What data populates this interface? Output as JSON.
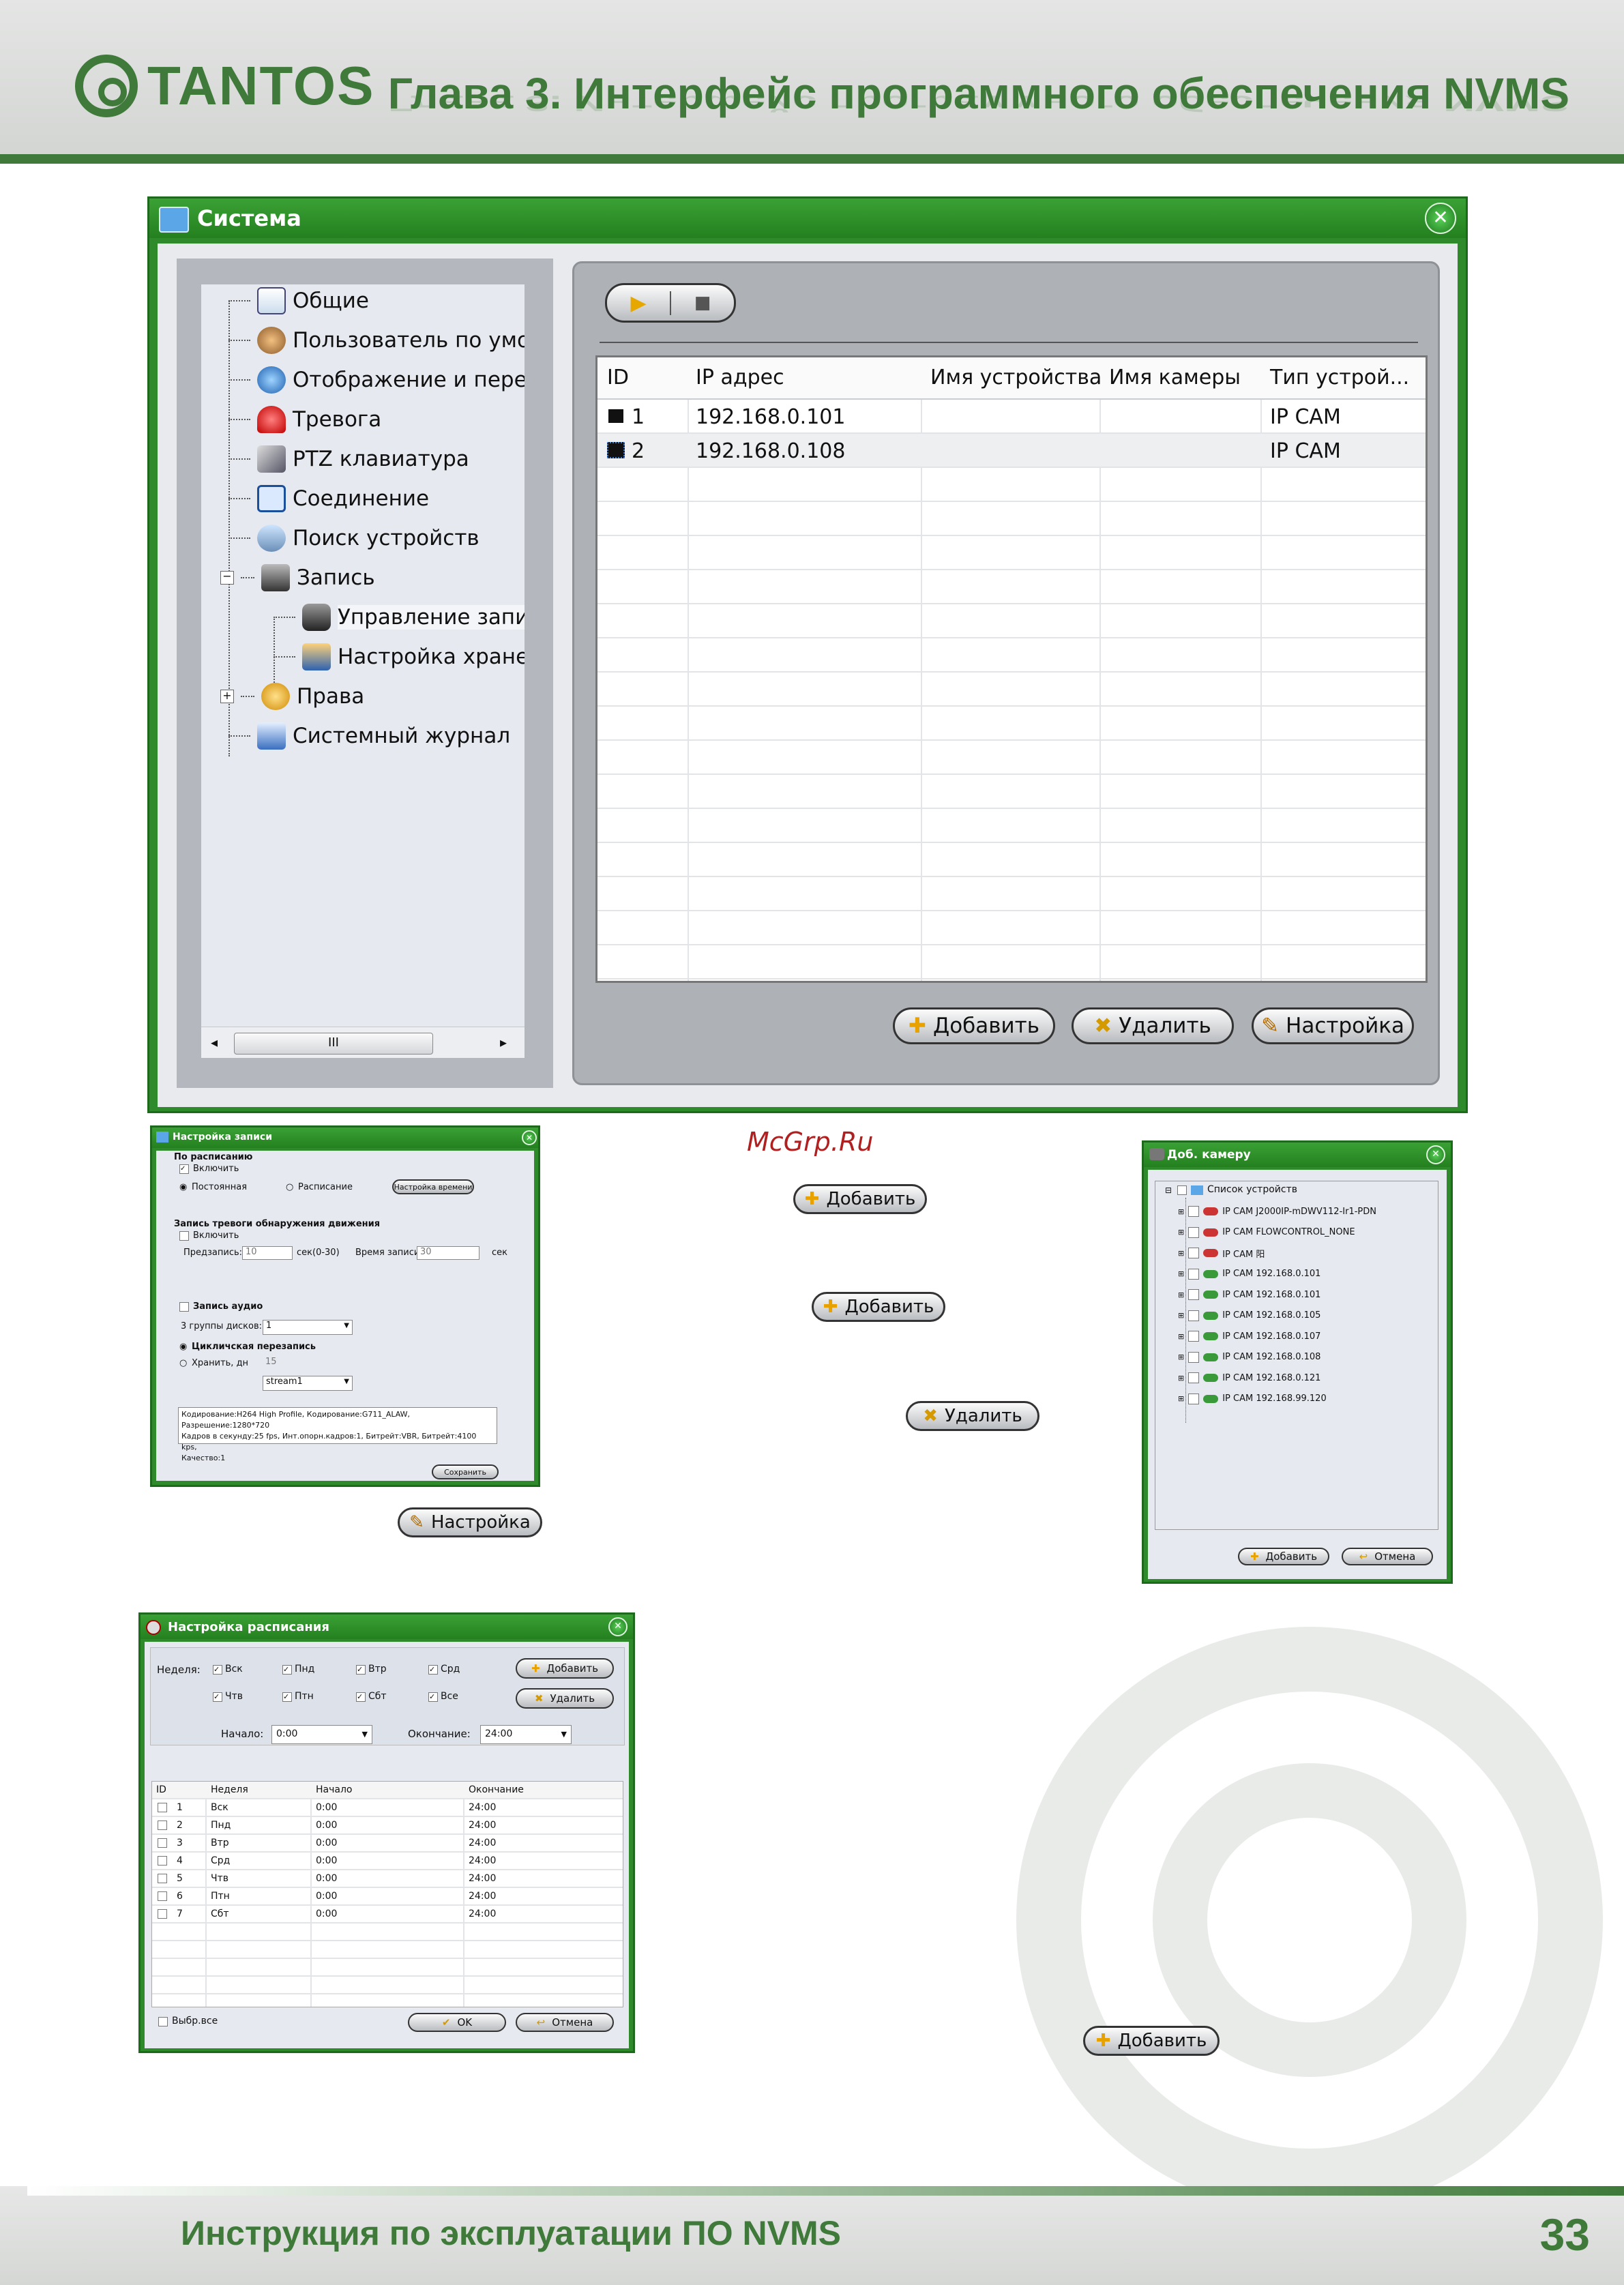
{
  "page": {
    "chapter_title": "Глава 3. Интерфейс программного обеспечения NVMS",
    "logo_text": "TANTOS",
    "footer_text": "Инструкция по эксплуатации ПО NVMS",
    "page_number": "33",
    "watermark_site": "McGrp.Ru",
    "colors": {
      "brand_green": "#3f7a3a",
      "window_green": "#2f8a2b"
    }
  },
  "system_window": {
    "title": "Система",
    "tree": [
      {
        "label": "Общие",
        "icon": "general-settings-icon"
      },
      {
        "label": "Пользователь по умол",
        "icon": "default-user-icon"
      },
      {
        "label": "Отображение и переда",
        "icon": "display-monitor-icon"
      },
      {
        "label": "Тревога",
        "icon": "alarm-siren-icon"
      },
      {
        "label": "PTZ клавиатура",
        "icon": "ptz-keyboard-icon"
      },
      {
        "label": "Соединение",
        "icon": "network-connection-icon"
      },
      {
        "label": "Поиск устройств",
        "icon": "device-search-icon"
      },
      {
        "label": "Запись",
        "icon": "recording-icon"
      },
      {
        "label": "Управление запис",
        "icon": "record-camera-icon"
      },
      {
        "label": "Настройка хранен",
        "icon": "storage-settings-icon"
      },
      {
        "label": "Права",
        "icon": "rights-users-icon"
      },
      {
        "label": "Системный журнал",
        "icon": "system-log-icon"
      }
    ],
    "scroll_thumb_glyph": "III",
    "table": {
      "columns": [
        "ID",
        "IP адрес",
        "Имя устройства",
        "Имя камеры",
        "Тип устрой..."
      ],
      "rows": [
        {
          "id": "1",
          "ip": "192.168.0.101",
          "device": "",
          "camera": "",
          "type": "IP CAM"
        },
        {
          "id": "2",
          "ip": "192.168.0.108",
          "device": "",
          "camera": "",
          "type": "IP CAM"
        }
      ]
    },
    "buttons": {
      "add": "Добавить",
      "delete": "Удалить",
      "settings": "Настройка"
    }
  },
  "record_settings": {
    "title": "Настройка записи",
    "schedule_group": "По расписанию",
    "enable": "Включить",
    "constant": "Постоянная",
    "schedule": "Расписание",
    "schedule_settings_btn": "Настройка времени",
    "motion_group": "Запись тревоги обнаружения движения",
    "motion_enable": "Включить",
    "prerecord_label": "Предзапись:",
    "prerecord_value": "10",
    "prerecord_unit": "сек(0-30)",
    "record_time_label": "Время записи",
    "record_time_value": "30",
    "record_time_unit": "сек",
    "audio": "Запись аудио",
    "disk_group_label": "3 группы дисков:",
    "disk_group_value": "1",
    "cyclic": "Цикличская перезапись",
    "keep_days": "Хранить, дн",
    "keep_days_value": "15",
    "stream": "stream1",
    "info_lines": [
      "Кодирование:H264 High Profile, Кодирование:G711_ALAW, Разрешение:1280*720",
      "Кадров в секунду:25 fps, Инт.опорн.кадров:1, Битрейт:VBR, Битрейт:4100 kps,",
      "Качество:1"
    ],
    "save_btn": "Сохранить"
  },
  "standalone_buttons": {
    "add_1": "Добавить",
    "add_2": "Добавить",
    "delete": "Удалить",
    "settings": "Настройка",
    "add_3": "Добавить"
  },
  "add_camera": {
    "title": "Доб. камеру",
    "root": "Список устройств",
    "items": [
      "IP CAM J2000IP-mDWV112-Ir1-PDN",
      "IP CAM FLOWCONTROL_NONE",
      "IP CAM 阳",
      "IP CAM 192.168.0.101",
      "IP CAM 192.168.0.101",
      "IP CAM 192.168.0.105",
      "IP CAM 192.168.0.107",
      "IP CAM 192.168.0.108",
      "IP CAM 192.168.0.121",
      "IP CAM 192.168.99.120"
    ],
    "add_btn": "Добавить",
    "cancel_btn": "Отмена"
  },
  "schedule_window": {
    "title": "Настройка расписания",
    "week_label": "Неделя:",
    "days_row1": [
      "Вск",
      "Пнд",
      "Втр",
      "Срд"
    ],
    "days_row2": [
      "Чтв",
      "Птн",
      "Сбт",
      "Все"
    ],
    "add_btn": "Добавить",
    "delete_btn": "Удалить",
    "start_label": "Начало:",
    "start_value": "0:00",
    "end_label": "Окончание:",
    "end_value": "24:00",
    "columns": [
      "ID",
      "Неделя",
      "Начало",
      "Окончание"
    ],
    "rows": [
      {
        "id": "1",
        "day": "Вск",
        "start": "0:00",
        "end": "24:00"
      },
      {
        "id": "2",
        "day": "Пнд",
        "start": "0:00",
        "end": "24:00"
      },
      {
        "id": "3",
        "day": "Втр",
        "start": "0:00",
        "end": "24:00"
      },
      {
        "id": "4",
        "day": "Срд",
        "start": "0:00",
        "end": "24:00"
      },
      {
        "id": "5",
        "day": "Чтв",
        "start": "0:00",
        "end": "24:00"
      },
      {
        "id": "6",
        "day": "Птн",
        "start": "0:00",
        "end": "24:00"
      },
      {
        "id": "7",
        "day": "Сбт",
        "start": "0:00",
        "end": "24:00"
      }
    ],
    "select_all": "Выбр.все",
    "ok_btn": "OK",
    "cancel_btn": "Отмена"
  }
}
